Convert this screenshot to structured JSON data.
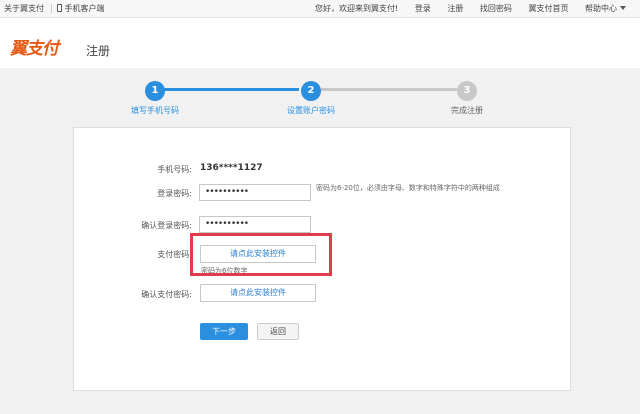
{
  "topbar": {
    "about": "关于翼支付",
    "mobile_client": "手机客户端",
    "welcome": "您好，欢迎来到翼支付!",
    "login": "登录",
    "register": "注册",
    "retrieve_password": "找回密码",
    "home": "翼支付首页",
    "help_center": "帮助中心"
  },
  "header": {
    "logo_text": "翼支付",
    "page_title": "注册"
  },
  "steps": [
    {
      "number": "1",
      "label": "填写手机号码"
    },
    {
      "number": "2",
      "label": "设置账户密码"
    },
    {
      "number": "3",
      "label": "完成注册"
    }
  ],
  "colors": {
    "accent": "#2b8fe0",
    "inactive_step": "#c8c8c8",
    "highlight": "#e23b4a",
    "logo": "#e75a14"
  },
  "form": {
    "phone_label": "手机号码:",
    "phone_value": "136****1127",
    "login_pw_label": "登录密码:",
    "login_pw_value": "••••••••••",
    "login_pw_hint": "密码为6-20位，必须由字母、数字和特殊字符中的两种组成",
    "confirm_login_pw_label": "确认登录密码:",
    "confirm_login_pw_value": "••••••••••",
    "pay_pw_label": "支付密码:",
    "pay_pw_button": "请点此安装控件",
    "pay_pw_hint": "密码为6位数字",
    "confirm_pay_pw_label": "确认支付密码:",
    "confirm_pay_pw_button": "请点此安装控件",
    "next_button": "下一步",
    "back_button": "返回"
  }
}
